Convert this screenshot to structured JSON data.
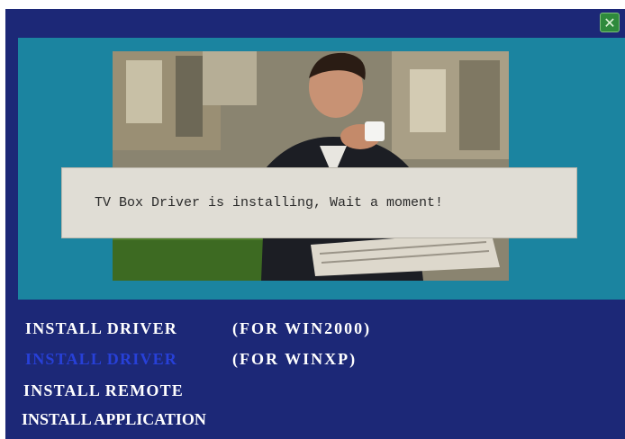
{
  "dialog": {
    "message": "TV Box Driver is installing, Wait a moment!"
  },
  "menu": [
    {
      "label": "INSTALL  DRIVER",
      "note": "(FOR WIN2000)"
    },
    {
      "label": "INSTALL  DRIVER",
      "note": "(FOR WINXP)"
    },
    {
      "label": "INSTALL  REMOTE"
    },
    {
      "label": "INSTALL APPLICATION"
    }
  ],
  "colors": {
    "window_bg": "#1c2877",
    "hero_bg": "#1b84a0",
    "active_item": "#2740d8",
    "dialog_bg": "#e0ddd5"
  },
  "icons": {
    "close": "close-icon"
  }
}
